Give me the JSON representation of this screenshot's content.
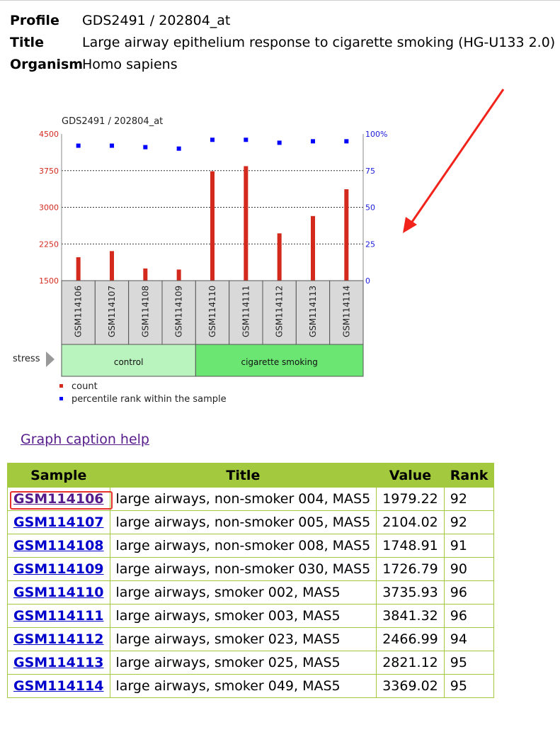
{
  "meta": {
    "profile_label": "Profile",
    "profile_value": "GDS2491 / 202804_at",
    "title_label": "Title",
    "title_value": "Large airway epithelium response to cigarette smoking (HG-U133 2.0)",
    "organism_label": "Organism",
    "organism_value": "Homo sapiens"
  },
  "chart_data": {
    "type": "bar",
    "title": "GDS2491 / 202804_at",
    "categories": [
      "GSM114106",
      "GSM114107",
      "GSM114108",
      "GSM114109",
      "GSM114110",
      "GSM114111",
      "GSM114112",
      "GSM114113",
      "GSM114114"
    ],
    "series": [
      {
        "name": "count",
        "type": "bar",
        "axis": "left",
        "color": "#d42a1e",
        "values": [
          1979.22,
          2104.02,
          1748.91,
          1726.79,
          3735.93,
          3841.32,
          2466.99,
          2821.12,
          3369.02
        ]
      },
      {
        "name": "percentile rank within the sample",
        "type": "scatter",
        "axis": "right",
        "color": "#0000ff",
        "values": [
          92,
          92,
          91,
          90,
          96,
          96,
          94,
          95,
          95
        ]
      }
    ],
    "y_left": {
      "ticks": [
        "4500",
        "3750",
        "3000",
        "2250",
        "1500"
      ],
      "ylim": [
        1500,
        4500
      ],
      "color": "#d42a1e"
    },
    "y_right": {
      "ticks": [
        "100%",
        "75",
        "50",
        "25",
        "0"
      ],
      "ylim": [
        0,
        100
      ],
      "color": "#1a1adb"
    },
    "grid": true,
    "groups": {
      "label": "stress",
      "items": [
        {
          "name": "control",
          "count": 4,
          "color": "#b9f3bd"
        },
        {
          "name": "cigarette smoking",
          "count": 5,
          "color": "#6be673"
        }
      ]
    },
    "legend": [
      {
        "label": "count",
        "color": "#d42a1e"
      },
      {
        "label": "percentile rank within the sample",
        "color": "#0000ff"
      }
    ]
  },
  "caption_help": "Graph caption help",
  "table": {
    "headers": [
      "Sample",
      "Title",
      "Value",
      "Rank"
    ],
    "rows": [
      {
        "sample": "GSM114106",
        "title": "large airways, non-smoker 004, MAS5",
        "value": "1979.22",
        "rank": "92"
      },
      {
        "sample": "GSM114107",
        "title": "large airways, non-smoker 005, MAS5",
        "value": "2104.02",
        "rank": "92"
      },
      {
        "sample": "GSM114108",
        "title": "large airways, non-smoker 008, MAS5",
        "value": "1748.91",
        "rank": "91"
      },
      {
        "sample": "GSM114109",
        "title": "large airways, non-smoker 030, MAS5",
        "value": "1726.79",
        "rank": "90"
      },
      {
        "sample": "GSM114110",
        "title": "large airways, smoker 002, MAS5",
        "value": "3735.93",
        "rank": "96"
      },
      {
        "sample": "GSM114111",
        "title": "large airways, smoker 003, MAS5",
        "value": "3841.32",
        "rank": "96"
      },
      {
        "sample": "GSM114112",
        "title": "large airways, smoker 023, MAS5",
        "value": "2466.99",
        "rank": "94"
      },
      {
        "sample": "GSM114113",
        "title": "large airways, smoker 025, MAS5",
        "value": "2821.12",
        "rank": "95"
      },
      {
        "sample": "GSM114114",
        "title": "large airways, smoker 049, MAS5",
        "value": "3369.02",
        "rank": "95"
      }
    ],
    "header_color": "#a3c93f"
  },
  "annotations": {
    "highlight_color": "#e8312a",
    "arrow_color": "#f2231b"
  }
}
